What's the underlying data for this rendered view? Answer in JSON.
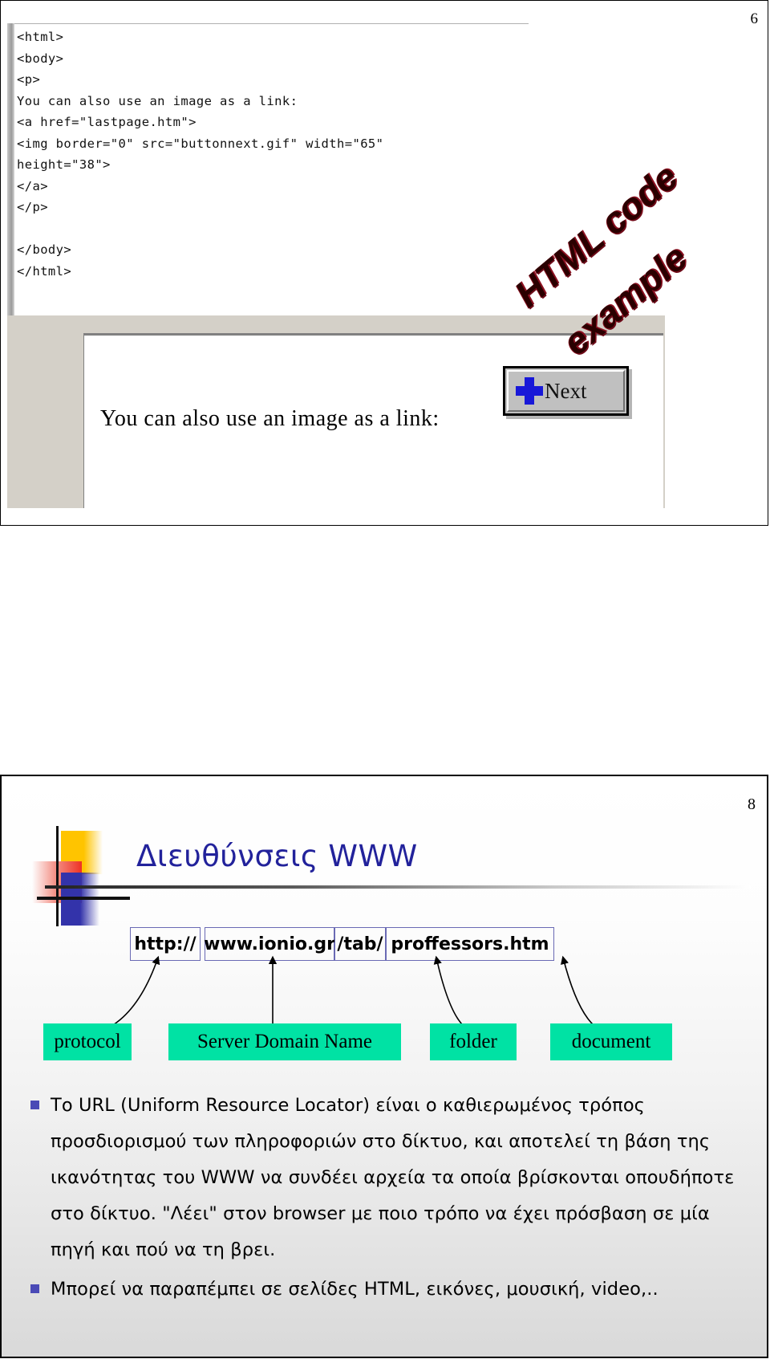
{
  "slide1": {
    "number": "6",
    "code_lines": [
      "<html>",
      "<body>",
      "<p>",
      "You can also use an image as a link:",
      "<a href=\"lastpage.htm\">",
      "<img border=\"0\" src=\"buttonnext.gif\" width=\"65\"",
      "height=\"38\">",
      "</a>",
      "</p>",
      "",
      "</body>",
      "</html>"
    ],
    "code_block": "<html>\n<body>\n<p>\nYou can also use an image as a link:\n<a href=\"lastpage.htm\">\n<img border=\"0\" src=\"buttonnext.gif\" width=\"65\"\nheight=\"38\">\n</a>\n</p>\n\n</body>\n</html>",
    "preview": {
      "text": "You can also use an image as a link:",
      "button_label": "Next",
      "button_icon": "blue-plus-icon"
    },
    "watermark": {
      "line1": "HTML code",
      "line2": "example",
      "color": "#8b1020"
    }
  },
  "slide2": {
    "number": "8",
    "title": "Διευθύνσεις WWW",
    "title_color": "#22229B",
    "url_parts": [
      {
        "id": "protocol",
        "text": "http://"
      },
      {
        "id": "domain",
        "text": "www.ionio.gr"
      },
      {
        "id": "folder",
        "text": "/tab/"
      },
      {
        "id": "document",
        "text": "proffessors.htm"
      }
    ],
    "labels": [
      {
        "id": "protocol",
        "text": "protocol"
      },
      {
        "id": "domain",
        "text": "Server Domain Name"
      },
      {
        "id": "folder",
        "text": "folder"
      },
      {
        "id": "document",
        "text": "document"
      }
    ],
    "label_color": "#00E2A4",
    "bullet_color": "#4a4ab6",
    "bullets": [
      "Το URL (Uniform Resource Locator) είναι ο καθιερωμένος τρόπος προσδιορισμού των πληροφοριών στο δίκτυο, και αποτελεί τη βάση της ικανότητας του WWW να συνδέει αρχεία τα οποία βρίσκονται οπουδήποτε στο δίκτυο. \"Λέει\" στον browser με ποιο τρόπο να έχει πρόσβαση σε μία πηγή και πού να τη βρει.",
      "Μπορεί να παραπέμπει σε σελίδες HTML, εικόνες, μουσική, video,.."
    ]
  }
}
